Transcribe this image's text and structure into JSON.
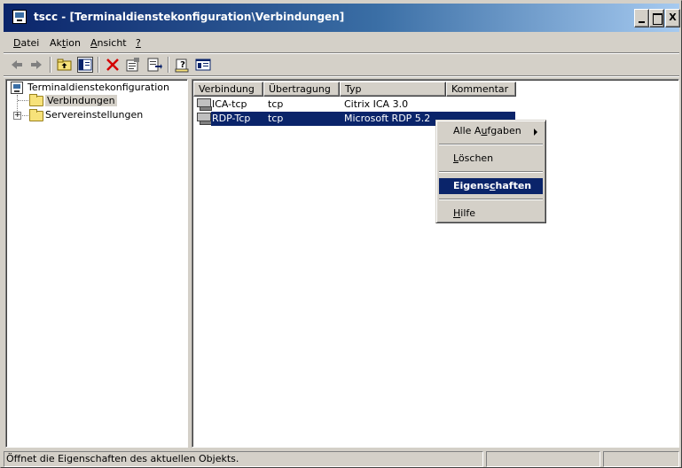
{
  "window": {
    "title": "tscc - [Terminaldienstekonfiguration\\Verbindungen]",
    "title_bar_color": "#0a246a"
  },
  "caption_buttons": {
    "minimize": "",
    "maximize": "",
    "close": "X"
  },
  "menu": {
    "items": [
      {
        "pre": "",
        "accel": "D",
        "post": "atei"
      },
      {
        "pre": "Ak",
        "accel": "t",
        "post": "ion"
      },
      {
        "pre": "",
        "accel": "A",
        "post": "nsicht"
      },
      {
        "pre": "",
        "accel": "?",
        "post": ""
      }
    ]
  },
  "toolbar": {
    "icons": [
      "back-arrow-icon",
      "forward-arrow-icon",
      "up-folder-icon",
      "show-hide-tree-icon",
      "delete-icon",
      "properties-icon",
      "export-list-icon",
      "help-icon",
      "console-icon"
    ]
  },
  "tree": {
    "root": "Terminaldienstekonfiguration",
    "children": [
      {
        "label": "Verbindungen",
        "selected": true
      },
      {
        "label": "Servereinstellungen",
        "expandable": true,
        "expander": "+"
      }
    ]
  },
  "list": {
    "columns": [
      "Verbindung",
      "Übertragung",
      "Typ",
      "Kommentar"
    ],
    "rows": [
      {
        "connection": "ICA-tcp",
        "transport": "tcp",
        "type": "Citrix ICA 3.0",
        "comment": "",
        "selected": false
      },
      {
        "connection": "RDP-Tcp",
        "transport": "tcp",
        "type": "Microsoft RDP 5.2",
        "comment": "",
        "selected": true
      }
    ]
  },
  "context_menu": {
    "items": [
      {
        "pre": "Alle A",
        "accel": "u",
        "post": "fgaben",
        "submenu": true
      },
      {
        "pre": "",
        "accel": "L",
        "post": "öschen"
      },
      {
        "pre": "Eigens",
        "accel": "c",
        "post": "haften",
        "highlighted": true
      },
      {
        "pre": "",
        "accel": "H",
        "post": "ilfe"
      }
    ]
  },
  "status": {
    "text": "Öffnet die Eigenschaften des aktuellen Objekts.",
    "panel2": "",
    "panel3": ""
  },
  "colors": {
    "selection": "#0a246a",
    "face": "#d4d0c8",
    "delete_icon": "#d40000"
  }
}
